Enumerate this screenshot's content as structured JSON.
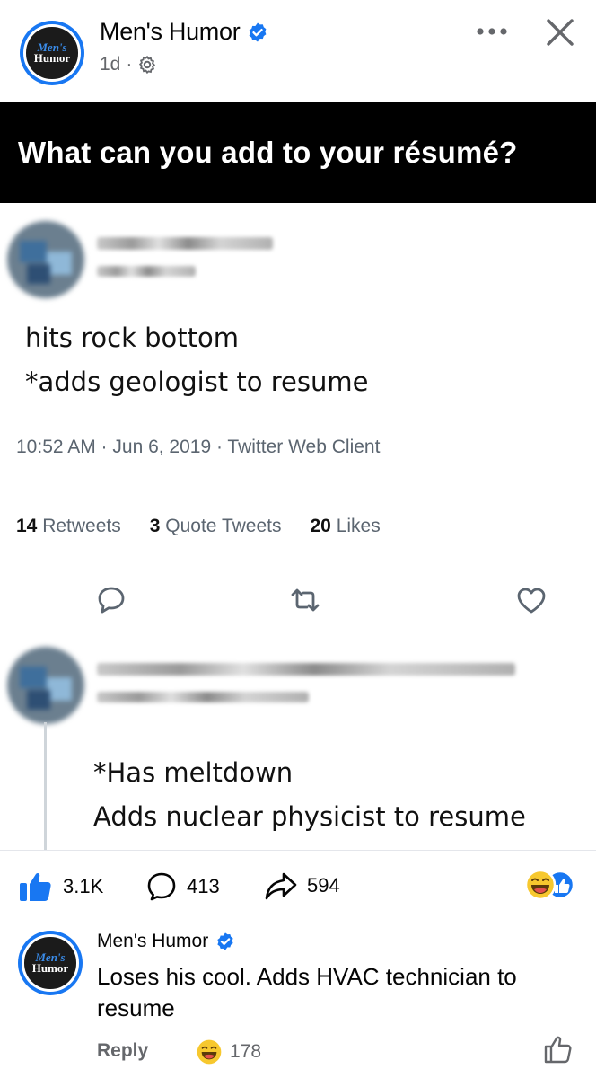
{
  "post": {
    "page_name": "Men's Humor",
    "time": "1d",
    "separator": "·",
    "avatar_line1": "Men's",
    "avatar_line2": "Humor"
  },
  "image": {
    "banner": "What can you add to your résumé?",
    "tweet1": {
      "line1": "hits rock bottom",
      "line2": "*adds geologist to resume",
      "timestamp": "10:52 AM · Jun 6, 2019 · Twitter Web Client",
      "retweets_count": "14",
      "retweets_label": "Retweets",
      "quotes_count": "3",
      "quotes_label": "Quote Tweets",
      "likes_count": "20",
      "likes_label": "Likes"
    },
    "tweet2": {
      "line1": "*Has meltdown",
      "line2": "Adds nuclear physicist to resume"
    }
  },
  "reactions": {
    "likes": "3.1K",
    "comments": "413",
    "shares": "594"
  },
  "comment": {
    "author": "Men's Humor",
    "text": "Loses his cool. Adds HVAC technician to resume",
    "reply_label": "Reply",
    "reaction_count": "178"
  },
  "colors": {
    "facebook_blue": "#1877f2",
    "secondary_text": "#65676b",
    "banner_bg": "#000000"
  },
  "icons": [
    "verified-badge-icon",
    "gear-icon",
    "more-options-icon",
    "close-icon",
    "reply-bubble-icon",
    "retweet-icon",
    "heart-icon",
    "like-thumb-icon",
    "comment-icon",
    "share-icon",
    "laugh-emoji-icon"
  ]
}
